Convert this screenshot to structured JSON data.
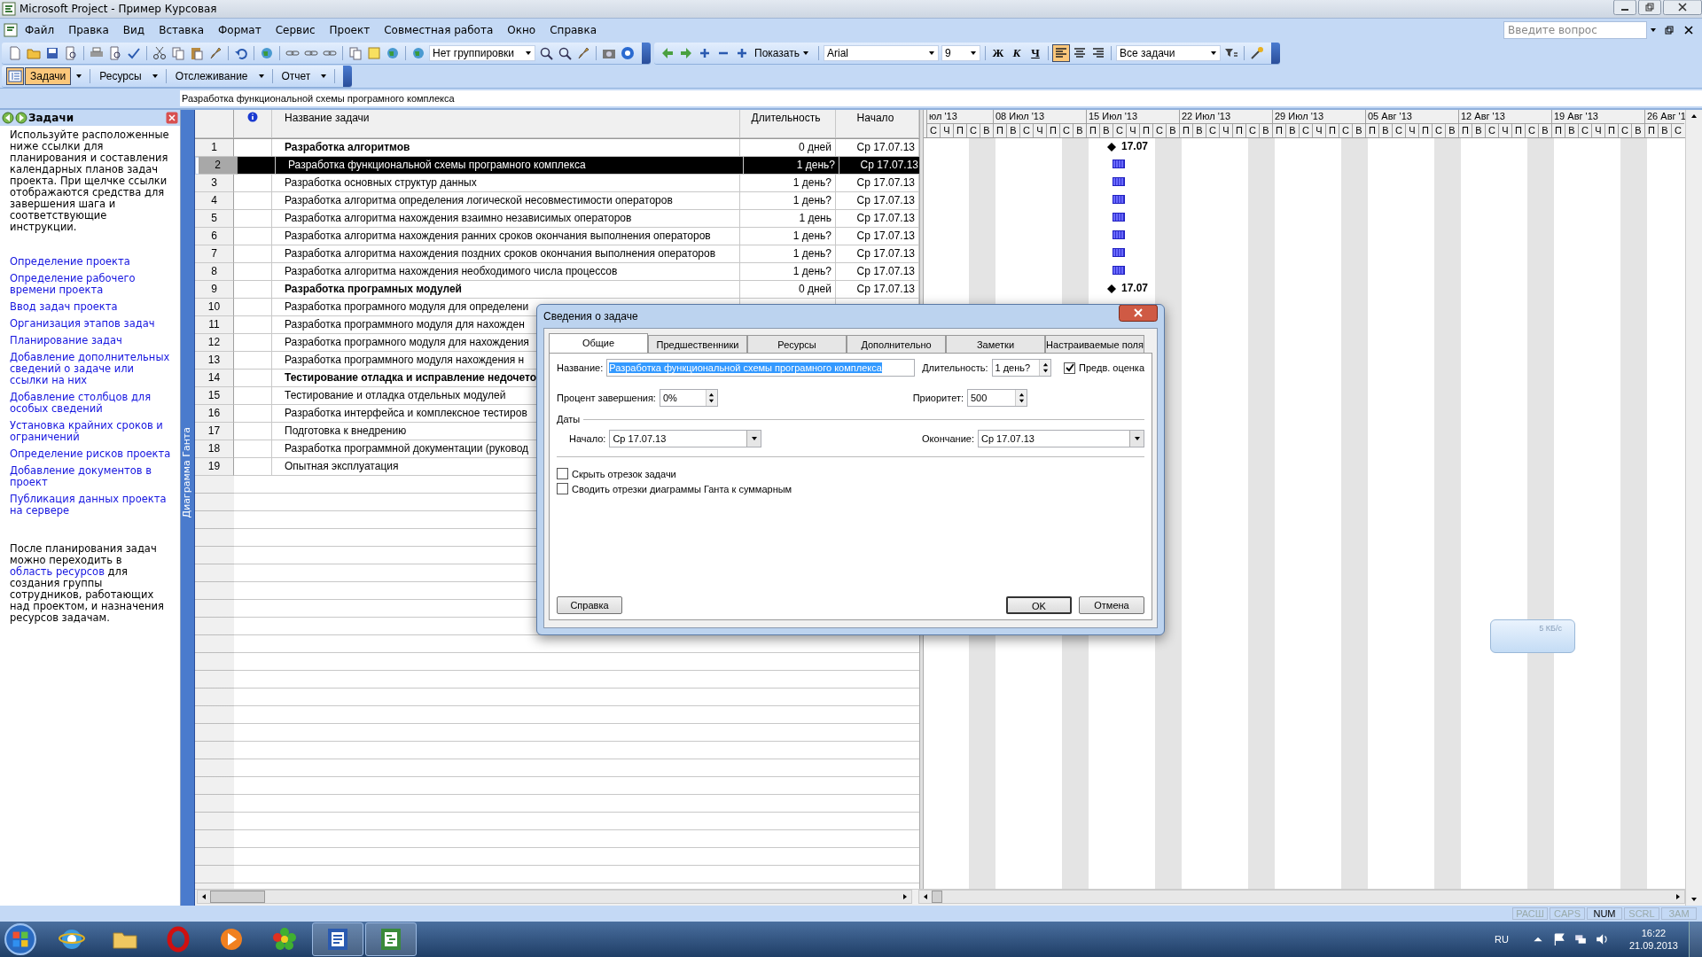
{
  "window": {
    "title": "Microsoft Project - Пример Курсовая"
  },
  "menu": [
    "Файл",
    "Правка",
    "Вид",
    "Вставка",
    "Формат",
    "Сервис",
    "Проект",
    "Совместная работа",
    "Окно",
    "Справка"
  ],
  "help_box": {
    "placeholder": "Введите вопрос"
  },
  "toolbar": {
    "grouping": "Нет группировки",
    "show": "Показать",
    "font": "Arial",
    "size": "9",
    "filter": "Все задачи"
  },
  "format_buttons": [
    {
      "label": "Ж"
    },
    {
      "label": "К"
    },
    {
      "label": "Ч"
    }
  ],
  "align_buttons": [
    {
      "selected": true
    },
    {
      "selected": false
    },
    {
      "selected": false
    }
  ],
  "guide_bar": [
    {
      "label": "Задачи",
      "selected": true
    },
    {
      "label": "Ресурсы",
      "selected": false
    },
    {
      "label": "Отслеживание",
      "selected": false
    },
    {
      "label": "Отчет",
      "selected": false
    }
  ],
  "entry_bar": {
    "value": "Разработка функциональной схемы програмного комплекса"
  },
  "task_pane": {
    "title": "Задачи",
    "intro": "Используйте расположенные ниже ссылки для планирования и составления календарных планов задач проекта. При щелчке ссылки отображаются средства для завершения шага и соответствующие инструкции.",
    "links": [
      "Определение проекта",
      "Определение рабочего времени проекта",
      "Ввод задач проекта",
      "Организация этапов задач",
      "Планирование задач",
      "Добавление дополнительных сведений о задаче или ссылки на них",
      "Добавление столбцов для особых сведений",
      "Установка крайних сроков и ограничений",
      "Определение рисков проекта",
      "Добавление документов в проект",
      "Публикация данных проекта на сервере"
    ],
    "outro_before": "После планирования задач можно переходить в",
    "outro_link": "область ресурсов",
    "outro_after": "для создания группы сотрудников, работающих над проектом, и назначения ресурсов задачам."
  },
  "view_bar": {
    "label": "Диаграмма Ганта"
  },
  "table": {
    "columns": [
      "Название задачи",
      "Длительность",
      "Начало"
    ],
    "rows": [
      {
        "id": "1",
        "name": "Разработка алгоритмов",
        "duration": "0 дней",
        "start": "Ср 17.07.13",
        "summary": true,
        "selected": false,
        "bar": {
          "kind": "milestone",
          "label": "17.07"
        }
      },
      {
        "id": "2",
        "name": "Разработка функциональной схемы програмного комплекса",
        "duration": "1 день?",
        "start": "Ср 17.07.13",
        "summary": false,
        "selected": true,
        "bar": {
          "kind": "task"
        }
      },
      {
        "id": "3",
        "name": "Разработка основных структур данных",
        "duration": "1 день?",
        "start": "Ср 17.07.13",
        "summary": false,
        "selected": false,
        "bar": {
          "kind": "task"
        }
      },
      {
        "id": "4",
        "name": "Разработка алгоритма определения логической несовместимости операторов",
        "duration": "1 день?",
        "start": "Ср 17.07.13",
        "summary": false,
        "selected": false,
        "bar": {
          "kind": "task"
        }
      },
      {
        "id": "5",
        "name": "Разработка алгоритма нахождения взаимно независимых операторов",
        "duration": "1 день",
        "start": "Ср 17.07.13",
        "summary": false,
        "selected": false,
        "bar": {
          "kind": "task"
        }
      },
      {
        "id": "6",
        "name": "Разработка алгоритма нахождения ранних сроков окончания выполнения операторов",
        "duration": "1 день?",
        "start": "Ср 17.07.13",
        "summary": false,
        "selected": false,
        "bar": {
          "kind": "task"
        }
      },
      {
        "id": "7",
        "name": "Разработка алгоритма нахождения поздних сроков окончания выполнения операторов",
        "duration": "1 день?",
        "start": "Ср 17.07.13",
        "summary": false,
        "selected": false,
        "bar": {
          "kind": "task"
        }
      },
      {
        "id": "8",
        "name": "Разработка алгоритма нахождения необходимого числа процессов",
        "duration": "1 день?",
        "start": "Ср 17.07.13",
        "summary": false,
        "selected": false,
        "bar": {
          "kind": "task"
        }
      },
      {
        "id": "9",
        "name": "Разработка програмных модулей",
        "duration": "0 дней",
        "start": "Ср 17.07.13",
        "summary": true,
        "selected": false,
        "bar": {
          "kind": "milestone",
          "label": "17.07"
        }
      },
      {
        "id": "10",
        "name": "Разработка програмного модуля для определени",
        "summary": false,
        "selected": false
      },
      {
        "id": "11",
        "name": "Разработка программного модуля для нахожден",
        "summary": false,
        "selected": false
      },
      {
        "id": "12",
        "name": "Разработка програмного модуля для нахождения",
        "summary": false,
        "selected": false
      },
      {
        "id": "13",
        "name": "Разработка программного модуля нахождения н",
        "summary": false,
        "selected": false
      },
      {
        "id": "14",
        "name": "Тестирование отладка и исправление недочето",
        "summary": true,
        "selected": false
      },
      {
        "id": "15",
        "name": "Тестирование и отладка отдельных модулей",
        "summary": false,
        "selected": false
      },
      {
        "id": "16",
        "name": "Разработка интерфейса и комплексное тестиров",
        "summary": false,
        "selected": false
      },
      {
        "id": "17",
        "name": "Подготовка к внедрению",
        "summary": false,
        "selected": false
      },
      {
        "id": "18",
        "name": "Разработка программной документации (руковод",
        "summary": false,
        "selected": false
      },
      {
        "id": "19",
        "name": "Опытная эксплуатация",
        "summary": false,
        "selected": false
      }
    ]
  },
  "gantt": {
    "weeks": [
      {
        "label": "юл '13",
        "days": [
          "С",
          "Ч",
          "П",
          "С",
          "В"
        ]
      },
      {
        "label": "08 Июл '13",
        "days": [
          "П",
          "В",
          "С",
          "Ч",
          "П",
          "С",
          "В"
        ]
      },
      {
        "label": "15 Июл '13",
        "days": [
          "П",
          "В",
          "С",
          "Ч",
          "П",
          "С",
          "В"
        ]
      },
      {
        "label": "22 Июл '13",
        "days": [
          "П",
          "В",
          "С",
          "Ч",
          "П",
          "С",
          "В"
        ]
      },
      {
        "label": "29 Июл '13",
        "days": [
          "П",
          "В",
          "С",
          "Ч",
          "П",
          "С",
          "В"
        ]
      },
      {
        "label": "05 Авг '13",
        "days": [
          "П",
          "В",
          "С",
          "Ч",
          "П",
          "С",
          "В"
        ]
      },
      {
        "label": "12 Авг '13",
        "days": [
          "П",
          "В",
          "С",
          "Ч",
          "П",
          "С",
          "В"
        ]
      },
      {
        "label": "19 Авг '13",
        "days": [
          "П",
          "В",
          "С",
          "Ч",
          "П",
          "С",
          "В"
        ]
      },
      {
        "label": "26 Авг '1",
        "days": [
          "П",
          "В",
          "С"
        ]
      }
    ]
  },
  "dialog": {
    "title": "Сведения о задаче",
    "tabs": [
      {
        "label": "Общие",
        "selected": true
      },
      {
        "label": "Предшественники",
        "selected": false
      },
      {
        "label": "Ресурсы",
        "selected": false
      },
      {
        "label": "Дополнительно",
        "selected": false
      },
      {
        "label": "Заметки",
        "selected": false
      },
      {
        "label": "Настраиваемые поля",
        "selected": false
      }
    ],
    "name_label": "Название:",
    "name_value": "Разработка функциональной схемы програмного комплекса",
    "name_highlighted": true,
    "duration_label": "Длительность:",
    "duration_value": "1 день?",
    "estimate": {
      "label": "Предв. оценка",
      "checked": true
    },
    "percent_label": "Процент завершения:",
    "percent_value": "0%",
    "priority_label": "Приоритет:",
    "priority_value": "500",
    "dates_label": "Даты",
    "start_label": "Начало:",
    "start_value": "Ср 17.07.13",
    "finish_label": "Окончание:",
    "finish_value": "Ср 17.07.13",
    "options": [
      {
        "label": "Скрыть отрезок задачи",
        "checked": false
      },
      {
        "label": "Сводить отрезки диаграммы Ганта к суммарным",
        "checked": false
      }
    ],
    "help_button": "Справка",
    "ok_button": "OK",
    "cancel_button": "Отмена"
  },
  "network_widget": {
    "reading": "5 КБ/с"
  },
  "status_bar": [
    {
      "label": "РАСШ",
      "on": false
    },
    {
      "label": "CAPS",
      "on": false
    },
    {
      "label": "NUM",
      "on": true
    },
    {
      "label": "SCRL",
      "on": false
    },
    {
      "label": "ЗАМ",
      "on": false
    }
  ],
  "taskbar": {
    "apps": [
      {
        "kind": "browser",
        "open": false
      },
      {
        "kind": "folder",
        "open": false
      },
      {
        "kind": "opera",
        "open": false
      },
      {
        "kind": "player",
        "open": false
      },
      {
        "kind": "flower",
        "open": false
      },
      {
        "kind": "word",
        "open": true
      },
      {
        "kind": "project",
        "open": true
      }
    ],
    "language": "RU",
    "time": "16:22",
    "date": "21.09.2013"
  }
}
